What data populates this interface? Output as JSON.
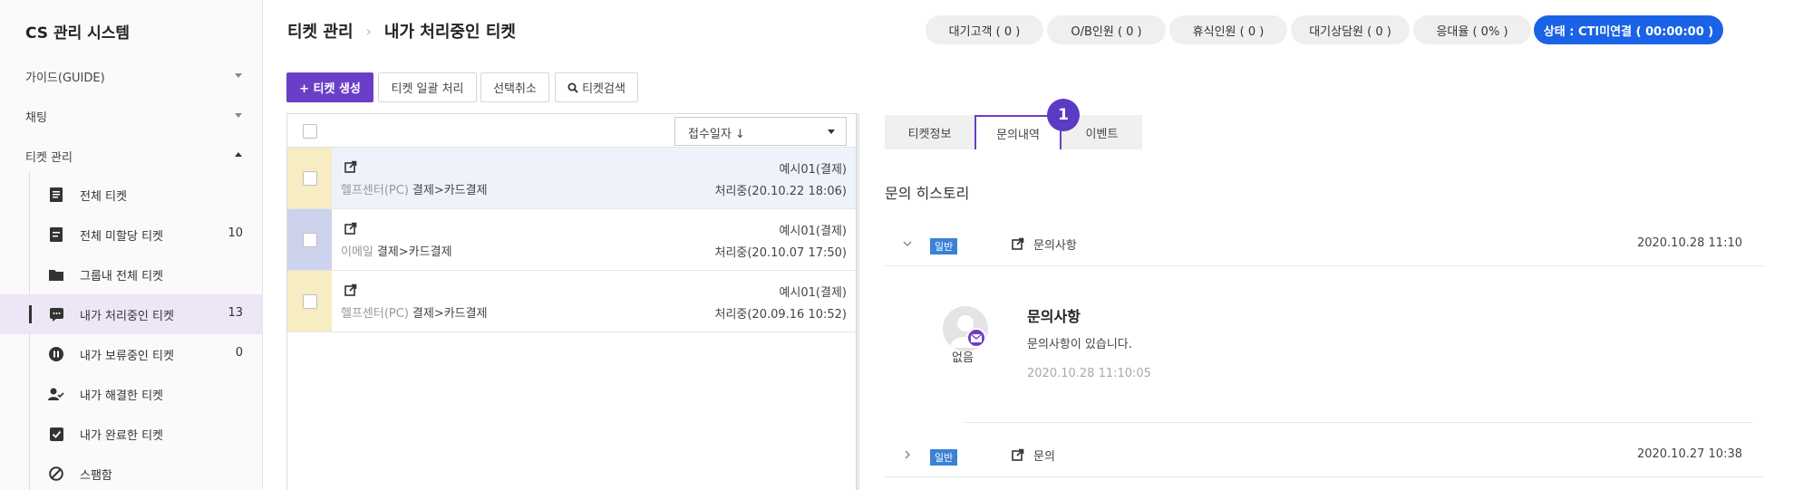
{
  "app": {
    "title": "CS 관리 시스템"
  },
  "sidebar": {
    "top_menus": [
      {
        "label": "가이드(GUIDE)",
        "expanded": false
      },
      {
        "label": "채팅",
        "expanded": false
      },
      {
        "label": "티켓 관리",
        "expanded": true
      }
    ],
    "sub_items": [
      {
        "label": "전체 티켓",
        "count": "",
        "icon": "document-list-icon",
        "active": false
      },
      {
        "label": "전체 미할당 티켓",
        "count": "10",
        "icon": "document-icon",
        "active": false
      },
      {
        "label": "그룹내 전체 티켓",
        "count": "",
        "icon": "folder-icon",
        "active": false
      },
      {
        "label": "내가 처리중인 티켓",
        "count": "13",
        "icon": "chat-bubble-icon",
        "active": true
      },
      {
        "label": "내가 보류중인 티켓",
        "count": "0",
        "icon": "pause-icon",
        "active": false
      },
      {
        "label": "내가 해결한 티켓",
        "count": "",
        "icon": "user-check-icon",
        "active": false
      },
      {
        "label": "내가 완료한 티켓",
        "count": "",
        "icon": "checkbox-icon",
        "active": false
      },
      {
        "label": "스팸함",
        "count": "",
        "icon": "block-icon",
        "active": false
      }
    ]
  },
  "header": {
    "breadcrumb_root": "티켓 관리",
    "breadcrumb_current": "내가 처리중인 티켓"
  },
  "stats": [
    {
      "label": "대기고객 ( 0 )"
    },
    {
      "label": "O/B인원 ( 0 )"
    },
    {
      "label": "휴식인원 ( 0 )"
    },
    {
      "label": "대기상담원 ( 0 )"
    },
    {
      "label": "응대율 ( 0% )"
    },
    {
      "label": "상태 : CTI미연결 ( 00:00:00 )"
    }
  ],
  "toolbar": {
    "create_label": "+ 티켓 생성",
    "bulk_label": "티켓 일괄 처리",
    "deselect_label": "선택취소",
    "search_label": "티켓검색"
  },
  "list": {
    "sort_label": "접수일자 ↓",
    "rows": [
      {
        "source": "헬프센터(PC)",
        "category": "결제>카드결제",
        "customer": "예시01(결제)",
        "status": "처리중(20.10.22 18:06)",
        "strip_color": "#f7ecc2",
        "selected": true
      },
      {
        "source": "이메일",
        "category": "결제>카드결제",
        "customer": "예시01(결제)",
        "status": "처리중(20.10.07 17:50)",
        "strip_color": "#cdd3ec",
        "selected": false
      },
      {
        "source": "헬프센터(PC)",
        "category": "결제>카드결제",
        "customer": "예시01(결제)",
        "status": "처리중(20.09.16 10:52)",
        "strip_color": "#f7ecc2",
        "selected": false
      }
    ]
  },
  "detail": {
    "tabs": [
      {
        "label": "티켓정보",
        "active": false
      },
      {
        "label": "문의내역",
        "active": true
      },
      {
        "label": "이벤트",
        "active": false
      }
    ],
    "step_badge": "1",
    "section_title": "문의 히스토리",
    "history": [
      {
        "badge": "일반",
        "title": "문의사항",
        "date": "2020.10.28 11:10",
        "expanded": true
      },
      {
        "badge": "일반",
        "title": "문의",
        "date": "2020.10.27 10:38",
        "expanded": false
      }
    ],
    "message": {
      "avatar_name": "없음",
      "title": "문의사항",
      "body": "문의사항이 있습니다.",
      "time": "2020.10.28 11:10:05"
    }
  },
  "colors": {
    "accent_purple": "#6a3fc8",
    "cti_blue": "#1a63e6",
    "badge_blue": "#3b82d6"
  }
}
